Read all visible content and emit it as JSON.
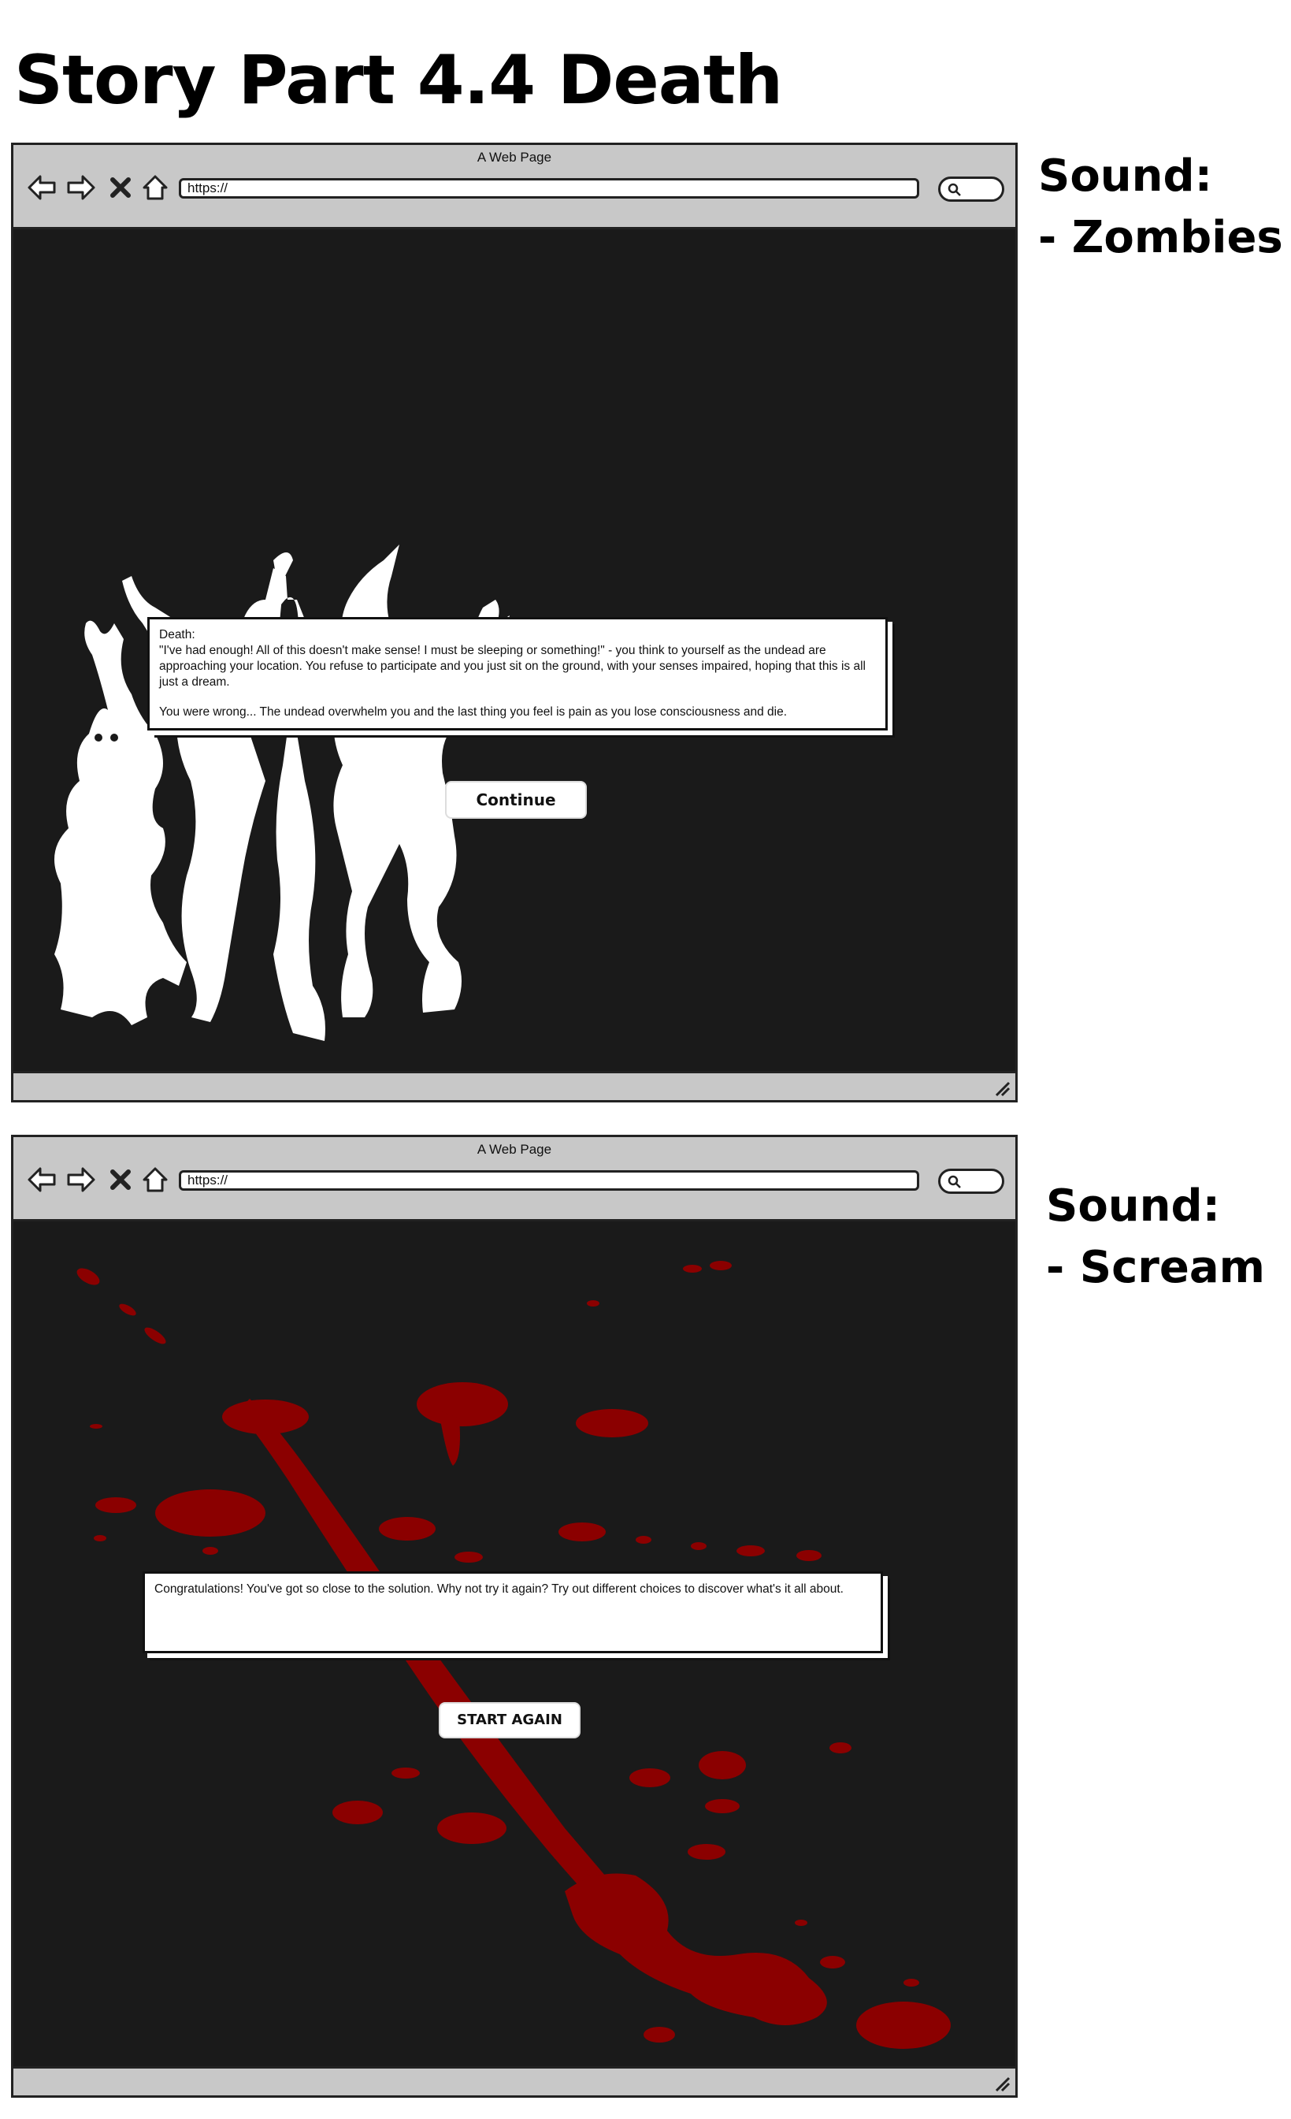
{
  "page": {
    "title": "Story Part 4.4 Death"
  },
  "screens": [
    {
      "window_title": "A Web Page",
      "url": "https://",
      "sound_heading": "Sound:",
      "sound_item": "- Zombies",
      "dialog": {
        "heading": "Death:",
        "paragraph1": "\"I've had enough! All of this doesn't make sense! I must be sleeping or something!\" - you think to yourself as the undead are approaching your location. You refuse to participate and you just sit on the ground, with your senses impaired, hoping that this is all just a dream.",
        "paragraph2": "You were wrong... The undead overwhelm you and the last thing you feel is pain as you lose consciousness and die."
      },
      "button_label": "Continue",
      "illustration": "zombie-silhouettes"
    },
    {
      "window_title": "A Web Page",
      "url": "https://",
      "sound_heading": "Sound:",
      "sound_item": "- Scream",
      "dialog": {
        "text": "Congratulations! You've got so close to the solution. Why not try it again? Try out different choices to discover what's it all about."
      },
      "button_label": "START AGAIN",
      "illustration": "blood-splatter"
    }
  ],
  "colors": {
    "viewport_bg": "#1a1a1a",
    "chrome_bg": "#c8c8c8",
    "blood": "#8b0000",
    "silhouette": "#ffffff"
  }
}
